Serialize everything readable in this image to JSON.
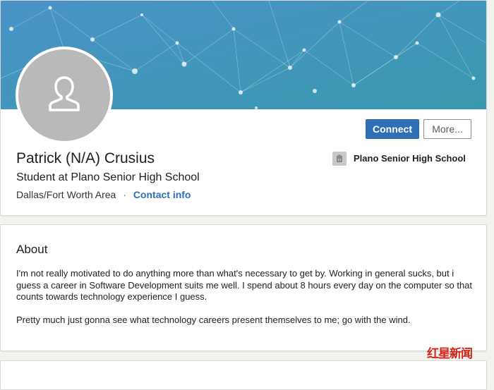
{
  "profile": {
    "name": "Patrick (N/A) Crusius",
    "headline": "Student at Plano Senior High School",
    "location": "Dallas/Fort Worth Area",
    "separator": "·",
    "contact_label": "Contact info",
    "school": "Plano Senior High School"
  },
  "actions": {
    "connect_label": "Connect",
    "more_label": "More..."
  },
  "about": {
    "title": "About",
    "paragraph1": "I'm not really motivated to do anything more than what's necessary to get by. Working in general sucks, but i guess a career in Software Development suits me well. I spend about 8 hours every day on the computer so that counts towards technology experience I guess.",
    "paragraph2": "Pretty much just gonna see what technology careers present themselves to me; go with the wind."
  },
  "watermark": "红星新闻",
  "colors": {
    "accent": "#2e6fb8",
    "banner": "#3f8fbf"
  },
  "icons": {
    "avatar": "person-silhouette-icon",
    "school": "school-building-icon"
  }
}
